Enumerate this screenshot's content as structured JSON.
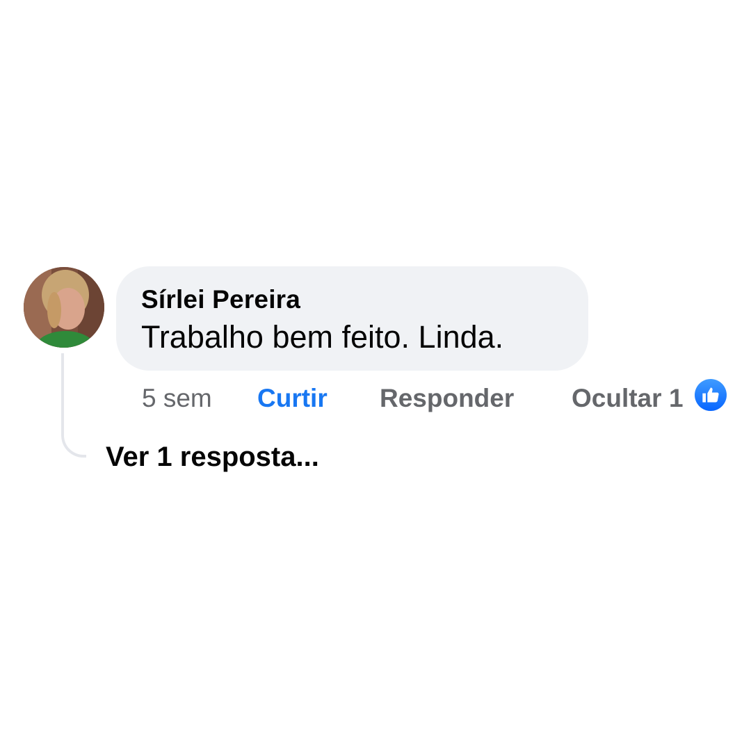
{
  "comment": {
    "author": "Sírlei Pereira",
    "text": "Trabalho bem feito. Linda.",
    "time": "5 sem",
    "actions": {
      "like_label": "Curtir",
      "reply_label": "Responder",
      "hide_label": "Ocultar"
    },
    "reaction_count": "1",
    "reaction_icon": "thumbs-up-icon",
    "view_replies_label": "Ver 1 resposta..."
  },
  "colors": {
    "like_active": "#1877f2",
    "secondary_text": "#65676b",
    "bubble_bg": "#f0f2f5",
    "primary_text": "#050505"
  }
}
